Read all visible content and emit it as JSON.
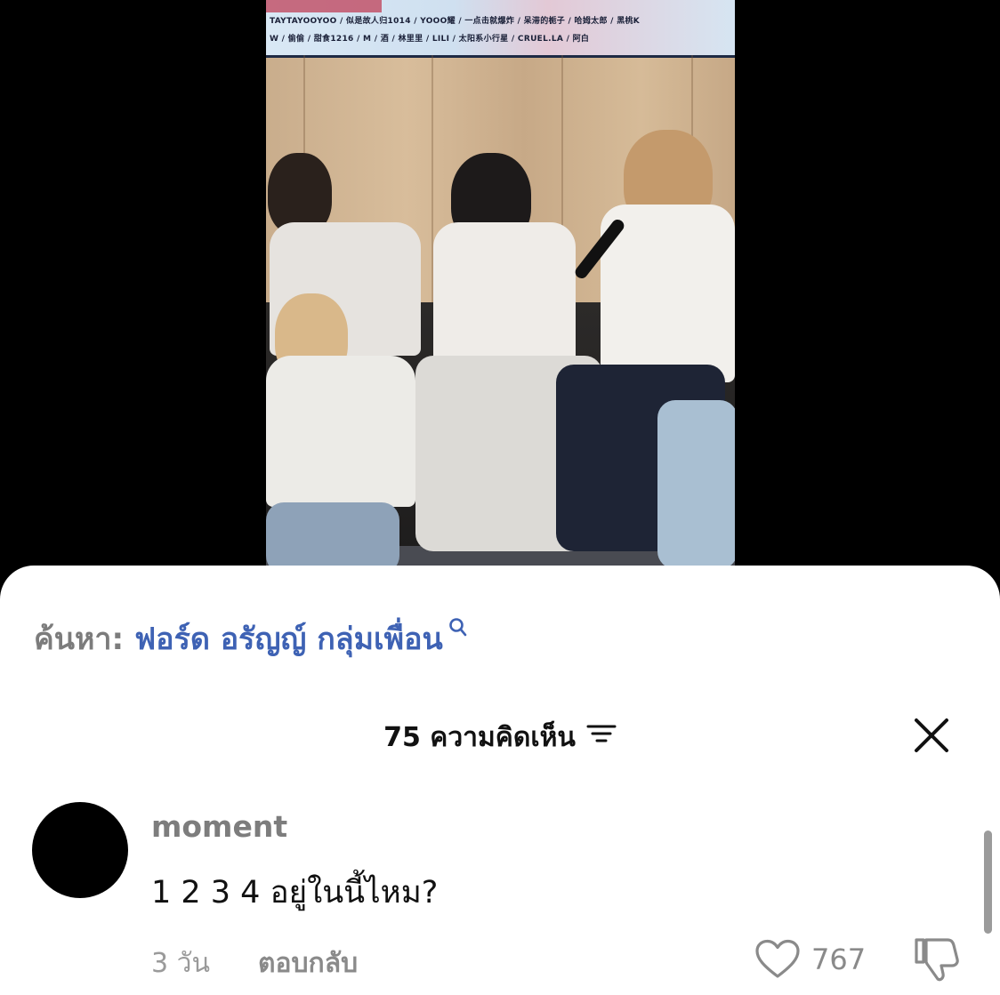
{
  "video": {
    "banner_line1": "TAYTAYOOYOO / 似是故人归1014 / YOOO耀 / 一点击就爆炸 / 呆滞的栀子 / 哈姆太郎 / 黑桃K",
    "banner_line2": "W / 偷偷 / 甜食1216 / M / 酒 / 林里里 / LILI / 太阳系小行星 / CRUEL.LA / 阿白"
  },
  "search": {
    "prefix": "ค้นหา:",
    "query": "ฟอร์ด อรัญญ์ กลุ่มเพื่อน",
    "icon": "search-icon"
  },
  "comments_header": {
    "title": "75 ความคิดเห็น",
    "sort_icon": "filter-sort-icon",
    "close_icon": "close-icon"
  },
  "comment": {
    "username": "moment",
    "text": "1 2 3 4 อยู่ในนี้ไหม?",
    "time": "3 วัน",
    "reply_label": "ตอบกลับ",
    "like_count": "767",
    "like_icon": "heart-icon",
    "dislike_icon": "thumbs-down-icon"
  },
  "colors": {
    "accent": "#3e62b4",
    "muted": "#7c7c7c"
  }
}
